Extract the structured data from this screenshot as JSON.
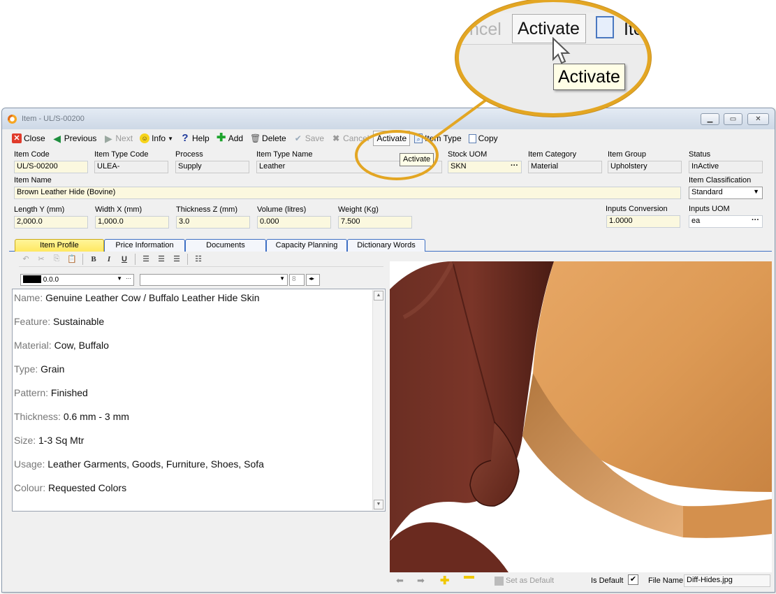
{
  "window": {
    "title": "Item - UL/S-00200"
  },
  "toolbar": {
    "close": "Close",
    "previous": "Previous",
    "next": "Next",
    "info": "Info",
    "help": "Help",
    "add": "Add",
    "delete": "Delete",
    "save": "Save",
    "cancel": "Cancel",
    "activate": "Activate",
    "item_type": "Item Type",
    "copy": "Copy"
  },
  "tooltip": "Activate",
  "zoom": {
    "cancel_fragment": "ncel",
    "activate": "Activate",
    "item_fragment": "Ite",
    "tooltip": "Activate"
  },
  "fields": {
    "item_code": {
      "label": "Item Code",
      "value": "UL/S-00200"
    },
    "item_type_code": {
      "label": "Item Type Code",
      "value": "ULEA-"
    },
    "process": {
      "label": "Process",
      "value": "Supply"
    },
    "item_type_name": {
      "label": "Item Type Name",
      "value": "Leather"
    },
    "stock_uom": {
      "label": "Stock UOM",
      "value": "SKN"
    },
    "item_category": {
      "label": "Item Category",
      "value": "Material"
    },
    "item_group": {
      "label": "Item Group",
      "value": "Upholstery"
    },
    "status": {
      "label": "Status",
      "value": "InActive"
    },
    "item_name": {
      "label": "Item Name",
      "value": "Brown Leather Hide (Bovine)"
    },
    "item_classification": {
      "label": "Item Classification",
      "value": "Standard"
    },
    "length": {
      "label": "Length Y (mm)",
      "value": "2,000.0"
    },
    "width": {
      "label": "Width X (mm)",
      "value": "1,000.0"
    },
    "thickness": {
      "label": "Thickness Z (mm)",
      "value": "3.0"
    },
    "volume": {
      "label": "Volume (litres)",
      "value": "0.000"
    },
    "weight": {
      "label": "Weight (Kg)",
      "value": "7.500"
    },
    "inputs_conversion": {
      "label": "Inputs Conversion",
      "value": "1.0000"
    },
    "inputs_uom": {
      "label": "Inputs UOM",
      "value": "ea"
    }
  },
  "tabs": [
    "Item Profile",
    "Price Information",
    "Documents",
    "Capacity Planning",
    "Dictionary Words"
  ],
  "editor": {
    "color_value": "0.0.0",
    "font_size": "8",
    "lines": [
      {
        "key": "Name:",
        "value": "Genuine Leather Cow / Buffalo Leather Hide Skin"
      },
      {
        "key": "Feature:",
        "value": "Sustainable"
      },
      {
        "key": "Material:",
        "value": "Cow, Buffalo"
      },
      {
        "key": "Type:",
        "value": "Grain"
      },
      {
        "key": "Pattern:",
        "value": "Finished"
      },
      {
        "key": "Thickness:",
        "value": "0.6 mm - 3 mm"
      },
      {
        "key": "Size:",
        "value": "1-3 Sq Mtr"
      },
      {
        "key": "Usage:",
        "value": "Leather Garments, Goods, Furniture, Shoes, Sofa"
      },
      {
        "key": "Colour:",
        "value": "Requested Colors"
      }
    ]
  },
  "image_panel": {
    "set_as_default": "Set as Default",
    "is_default_label": "Is Default",
    "is_default": true,
    "file_name_label": "File Name",
    "file_name": "Diff-Hides.jpg"
  },
  "colors": {
    "accent_ring": "#e3a623",
    "tab_active": "#ffe861",
    "field_bg": "#fbf8df"
  }
}
